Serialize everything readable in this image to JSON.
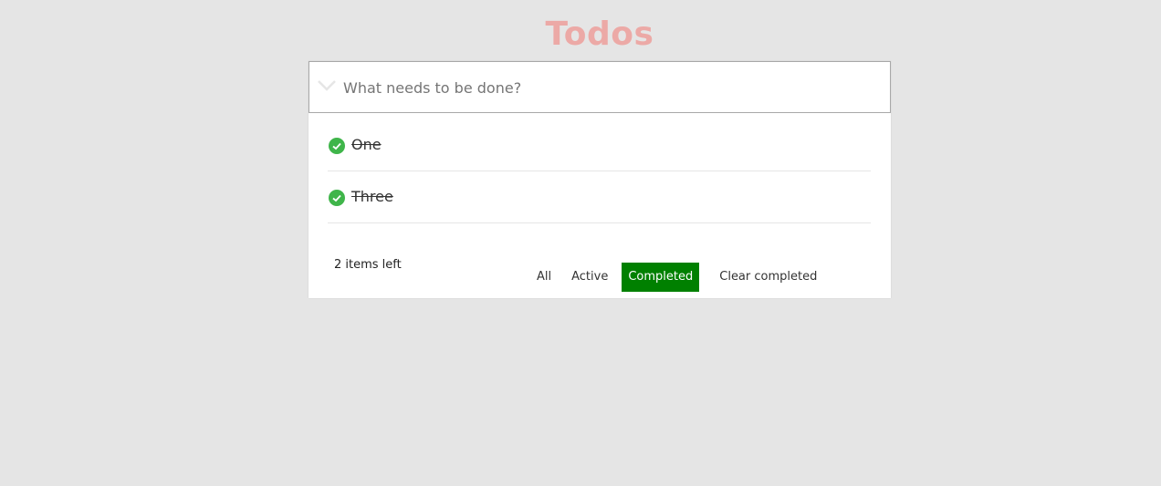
{
  "app": {
    "title": "Todos"
  },
  "new_todo": {
    "placeholder": "What needs to be done?",
    "toggle_all_icon": "chevron-down-icon"
  },
  "todos": [
    {
      "label": "One",
      "completed": true,
      "icon": "check-circle-icon"
    },
    {
      "label": "Three",
      "completed": true,
      "icon": "check-circle-icon"
    }
  ],
  "footer": {
    "count_text": "2 items left",
    "filters": {
      "all": "All",
      "active": "Active",
      "completed": "Completed"
    },
    "selected_filter": "Completed",
    "clear_completed": "Clear completed"
  },
  "colors": {
    "background": "#e5e5e5",
    "title": "#eca9a6",
    "check": "#3fb54a",
    "selected_filter_bg": "#008000"
  }
}
